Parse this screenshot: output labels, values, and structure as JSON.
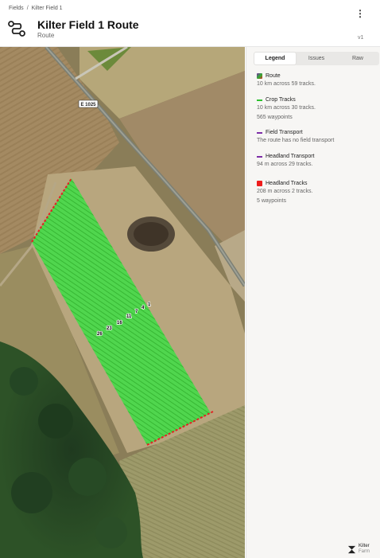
{
  "header": {
    "breadcrumb": [
      "Fields",
      "Kilter Field 1"
    ],
    "breadcrumb_sep": "/",
    "title": "Kilter Field 1 Route",
    "subtitle": "Route",
    "version": "v1",
    "menu_icon": "kebab-menu-icon",
    "page_icon": "route-icon"
  },
  "map": {
    "road_label": "E 1025",
    "track_labels": [
      "1",
      "4",
      "7",
      "11",
      "16",
      "23",
      "26"
    ],
    "colors": {
      "crop_tracks": "#3fd23f",
      "headland_tracks": "#e12424"
    }
  },
  "panel": {
    "tabs": [
      {
        "label": "Legend",
        "active": true
      },
      {
        "label": "Issues",
        "active": false
      },
      {
        "label": "Raw",
        "active": false
      }
    ],
    "legend": [
      {
        "key": "route",
        "label": "Route",
        "details": [
          "10 km across 59 tracks."
        ],
        "color": "#7d2ea8"
      },
      {
        "key": "crop",
        "label": "Crop Tracks",
        "details": [
          "10 km across 30 tracks.",
          "565 waypoints"
        ],
        "color": "#2fc22f"
      },
      {
        "key": "field",
        "label": "Field Transport",
        "details": [
          "The route has no field transport"
        ],
        "color": "#7d2ea8"
      },
      {
        "key": "headland_transport",
        "label": "Headland Transport",
        "details": [
          "94 m across 29 tracks."
        ],
        "color": "#7d2ea8"
      },
      {
        "key": "headland",
        "label": "Headland Tracks",
        "details": [
          "208 m across 2 tracks.",
          "5 waypoints"
        ],
        "color": "#ee1c1c"
      }
    ],
    "brand": {
      "name": "Kilter",
      "sub": "Farm",
      "icon": "kilter-logo-icon"
    }
  }
}
